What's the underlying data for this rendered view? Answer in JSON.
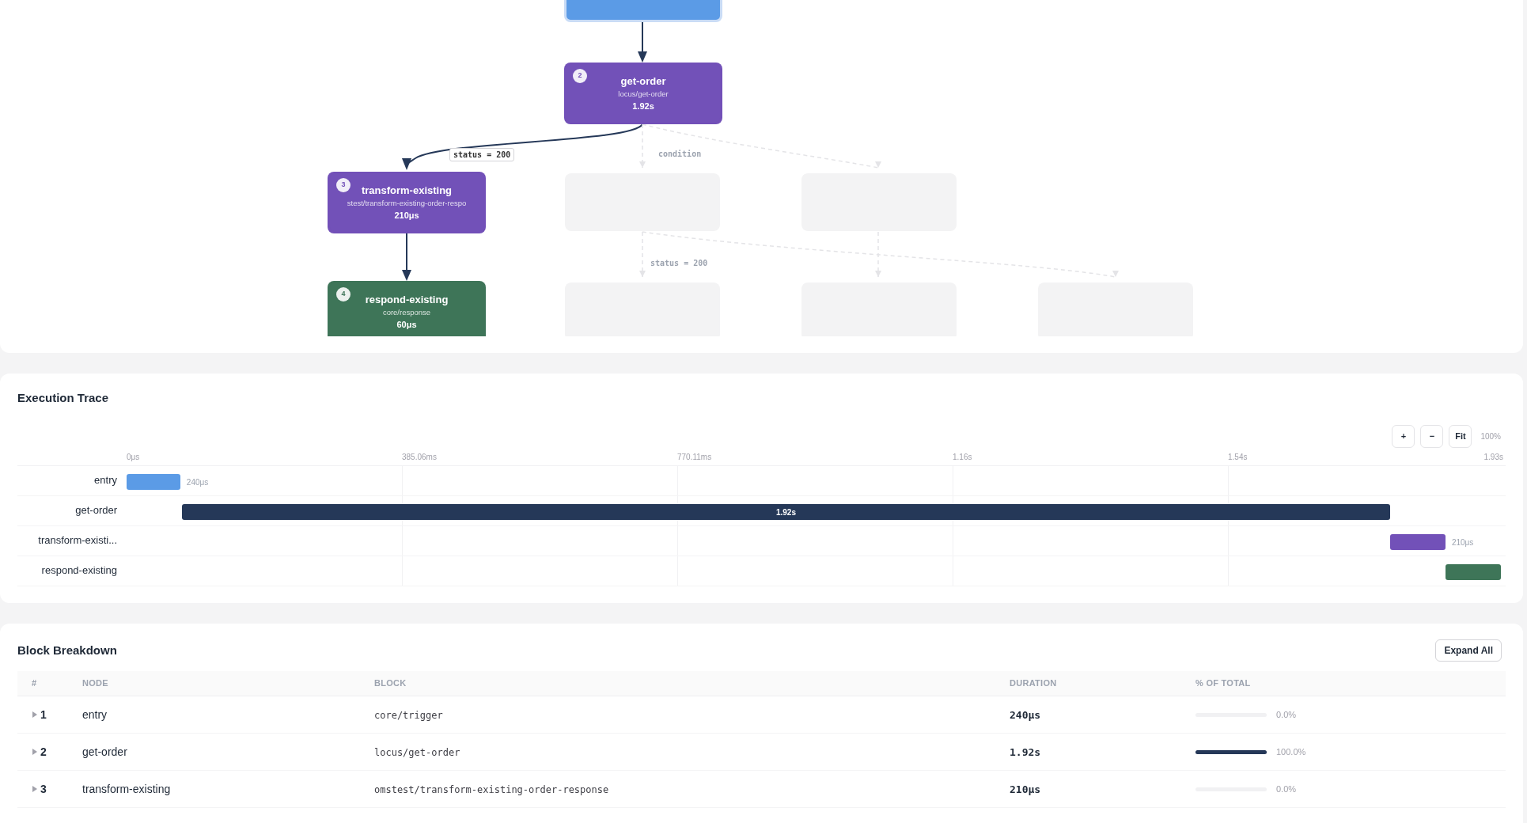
{
  "graph": {
    "nodes": [
      {
        "kind": "cut",
        "color": "#5b9be6"
      },
      {
        "kind": "active",
        "number": "2",
        "title": "get-order",
        "block": "locus/get-order",
        "duration": "1.92s",
        "color": "#7251b8"
      },
      {
        "kind": "active",
        "number": "3",
        "title": "transform-existing",
        "block": "stest/transform-existing-order-respo",
        "duration": "210μs",
        "color": "#7251b8"
      },
      {
        "kind": "active",
        "number": "4",
        "title": "respond-existing",
        "block": "core/response",
        "duration": "60μs",
        "color": "#3e7558"
      },
      {
        "kind": "skipped"
      },
      {
        "kind": "skipped"
      },
      {
        "kind": "skipped"
      },
      {
        "kind": "skipped"
      },
      {
        "kind": "skipped"
      }
    ],
    "edge_labels": [
      {
        "text": "status = 200",
        "kind": "taken"
      },
      {
        "text": "condition",
        "kind": "skipped"
      },
      {
        "text": "status = 200",
        "kind": "skipped"
      }
    ]
  },
  "trace": {
    "title": "Execution Trace",
    "zoom_buttons": [
      "+",
      "−",
      "Fit"
    ],
    "zoom_level": "100%",
    "ticks": [
      "0μs",
      "385.06ms",
      "770.11ms",
      "1.16s",
      "1.54s",
      "1.93s"
    ],
    "rows": [
      {
        "label": "entry",
        "color": "#5b9be6",
        "value": "240μs",
        "value_inside": false
      },
      {
        "label": "get-order",
        "color": "#253858",
        "value": "1.92s",
        "value_inside": true
      },
      {
        "label": "transform-existi...",
        "color": "#7251b8",
        "value": "210μs",
        "value_inside": false
      },
      {
        "label": "respond-existing",
        "color": "#3e7558"
      }
    ]
  },
  "breakdown": {
    "title": "Block Breakdown",
    "expand_button": "Expand All",
    "columns": [
      "#",
      "NODE",
      "BLOCK",
      "DURATION",
      "% OF TOTAL"
    ],
    "rows": [
      {
        "number": "1",
        "node": "entry",
        "block": "core/trigger",
        "duration": "240μs",
        "level": 0.0,
        "percent": "0.0%",
        "expanded": false
      },
      {
        "number": "2",
        "node": "get-order",
        "block": "locus/get-order",
        "duration": "1.92s",
        "level": 1.0,
        "percent": "100.0%",
        "expanded": false
      },
      {
        "number": "3",
        "node": "transform-existing",
        "block": "omstest/transform-existing-order-response",
        "duration": "210μs",
        "level": 0.0,
        "percent": "0.0%",
        "expanded": false
      }
    ]
  }
}
